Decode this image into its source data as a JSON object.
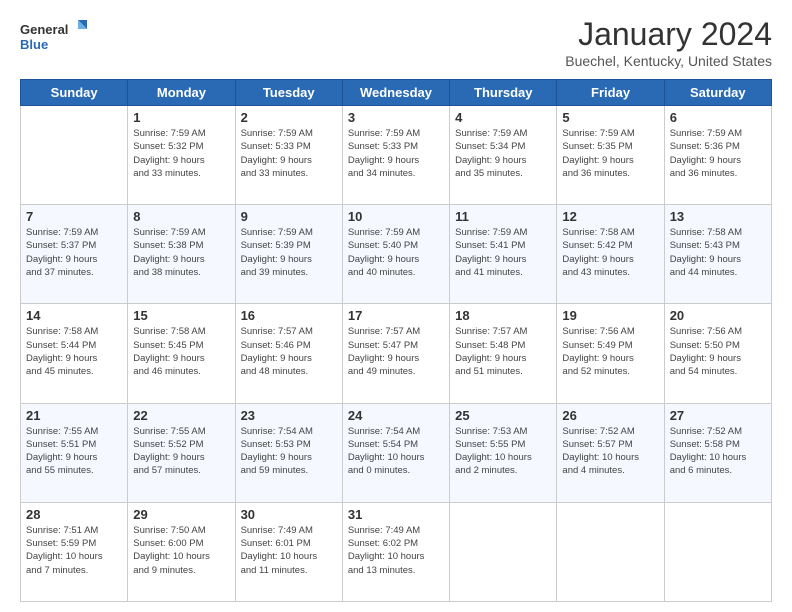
{
  "logo": {
    "line1": "General",
    "line2": "Blue"
  },
  "title": "January 2024",
  "location": "Buechel, Kentucky, United States",
  "days_of_week": [
    "Sunday",
    "Monday",
    "Tuesday",
    "Wednesday",
    "Thursday",
    "Friday",
    "Saturday"
  ],
  "weeks": [
    [
      {
        "day": "",
        "info": ""
      },
      {
        "day": "1",
        "info": "Sunrise: 7:59 AM\nSunset: 5:32 PM\nDaylight: 9 hours\nand 33 minutes."
      },
      {
        "day": "2",
        "info": "Sunrise: 7:59 AM\nSunset: 5:33 PM\nDaylight: 9 hours\nand 33 minutes."
      },
      {
        "day": "3",
        "info": "Sunrise: 7:59 AM\nSunset: 5:33 PM\nDaylight: 9 hours\nand 34 minutes."
      },
      {
        "day": "4",
        "info": "Sunrise: 7:59 AM\nSunset: 5:34 PM\nDaylight: 9 hours\nand 35 minutes."
      },
      {
        "day": "5",
        "info": "Sunrise: 7:59 AM\nSunset: 5:35 PM\nDaylight: 9 hours\nand 36 minutes."
      },
      {
        "day": "6",
        "info": "Sunrise: 7:59 AM\nSunset: 5:36 PM\nDaylight: 9 hours\nand 36 minutes."
      }
    ],
    [
      {
        "day": "7",
        "info": "Sunrise: 7:59 AM\nSunset: 5:37 PM\nDaylight: 9 hours\nand 37 minutes."
      },
      {
        "day": "8",
        "info": "Sunrise: 7:59 AM\nSunset: 5:38 PM\nDaylight: 9 hours\nand 38 minutes."
      },
      {
        "day": "9",
        "info": "Sunrise: 7:59 AM\nSunset: 5:39 PM\nDaylight: 9 hours\nand 39 minutes."
      },
      {
        "day": "10",
        "info": "Sunrise: 7:59 AM\nSunset: 5:40 PM\nDaylight: 9 hours\nand 40 minutes."
      },
      {
        "day": "11",
        "info": "Sunrise: 7:59 AM\nSunset: 5:41 PM\nDaylight: 9 hours\nand 41 minutes."
      },
      {
        "day": "12",
        "info": "Sunrise: 7:58 AM\nSunset: 5:42 PM\nDaylight: 9 hours\nand 43 minutes."
      },
      {
        "day": "13",
        "info": "Sunrise: 7:58 AM\nSunset: 5:43 PM\nDaylight: 9 hours\nand 44 minutes."
      }
    ],
    [
      {
        "day": "14",
        "info": "Sunrise: 7:58 AM\nSunset: 5:44 PM\nDaylight: 9 hours\nand 45 minutes."
      },
      {
        "day": "15",
        "info": "Sunrise: 7:58 AM\nSunset: 5:45 PM\nDaylight: 9 hours\nand 46 minutes."
      },
      {
        "day": "16",
        "info": "Sunrise: 7:57 AM\nSunset: 5:46 PM\nDaylight: 9 hours\nand 48 minutes."
      },
      {
        "day": "17",
        "info": "Sunrise: 7:57 AM\nSunset: 5:47 PM\nDaylight: 9 hours\nand 49 minutes."
      },
      {
        "day": "18",
        "info": "Sunrise: 7:57 AM\nSunset: 5:48 PM\nDaylight: 9 hours\nand 51 minutes."
      },
      {
        "day": "19",
        "info": "Sunrise: 7:56 AM\nSunset: 5:49 PM\nDaylight: 9 hours\nand 52 minutes."
      },
      {
        "day": "20",
        "info": "Sunrise: 7:56 AM\nSunset: 5:50 PM\nDaylight: 9 hours\nand 54 minutes."
      }
    ],
    [
      {
        "day": "21",
        "info": "Sunrise: 7:55 AM\nSunset: 5:51 PM\nDaylight: 9 hours\nand 55 minutes."
      },
      {
        "day": "22",
        "info": "Sunrise: 7:55 AM\nSunset: 5:52 PM\nDaylight: 9 hours\nand 57 minutes."
      },
      {
        "day": "23",
        "info": "Sunrise: 7:54 AM\nSunset: 5:53 PM\nDaylight: 9 hours\nand 59 minutes."
      },
      {
        "day": "24",
        "info": "Sunrise: 7:54 AM\nSunset: 5:54 PM\nDaylight: 10 hours\nand 0 minutes."
      },
      {
        "day": "25",
        "info": "Sunrise: 7:53 AM\nSunset: 5:55 PM\nDaylight: 10 hours\nand 2 minutes."
      },
      {
        "day": "26",
        "info": "Sunrise: 7:52 AM\nSunset: 5:57 PM\nDaylight: 10 hours\nand 4 minutes."
      },
      {
        "day": "27",
        "info": "Sunrise: 7:52 AM\nSunset: 5:58 PM\nDaylight: 10 hours\nand 6 minutes."
      }
    ],
    [
      {
        "day": "28",
        "info": "Sunrise: 7:51 AM\nSunset: 5:59 PM\nDaylight: 10 hours\nand 7 minutes."
      },
      {
        "day": "29",
        "info": "Sunrise: 7:50 AM\nSunset: 6:00 PM\nDaylight: 10 hours\nand 9 minutes."
      },
      {
        "day": "30",
        "info": "Sunrise: 7:49 AM\nSunset: 6:01 PM\nDaylight: 10 hours\nand 11 minutes."
      },
      {
        "day": "31",
        "info": "Sunrise: 7:49 AM\nSunset: 6:02 PM\nDaylight: 10 hours\nand 13 minutes."
      },
      {
        "day": "",
        "info": ""
      },
      {
        "day": "",
        "info": ""
      },
      {
        "day": "",
        "info": ""
      }
    ]
  ]
}
